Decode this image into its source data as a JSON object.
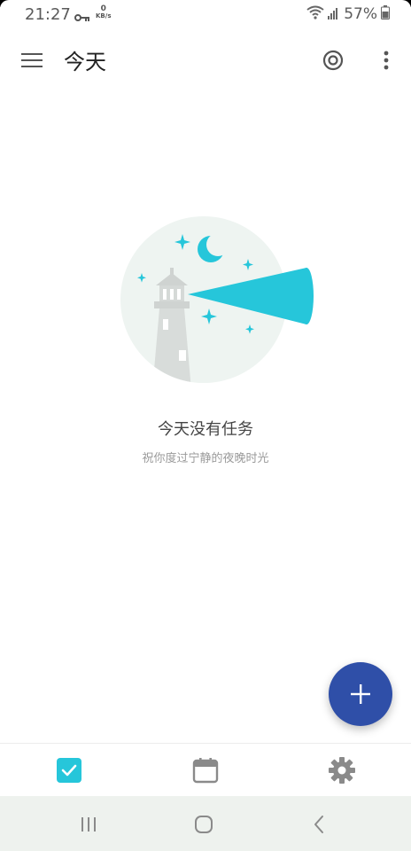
{
  "status_bar": {
    "time": "21:27",
    "net_speed_value": "0",
    "net_speed_unit": "KB/s",
    "battery": "57%",
    "icons": [
      "key-icon",
      "wifi-icon",
      "signal-icon",
      "battery-icon"
    ]
  },
  "app_bar": {
    "title": "今天",
    "icons": [
      "menu-icon",
      "focus-target-icon",
      "more-vert-icon"
    ]
  },
  "empty_state": {
    "title": "今天没有任务",
    "subtitle": "祝你度过宁静的夜晚时光",
    "illustration": "lighthouse-night-illustration"
  },
  "fab": {
    "label": "+",
    "icon": "plus-icon"
  },
  "bottom_nav": {
    "items": [
      {
        "name": "tasks",
        "icon": "checkbox-icon",
        "active": true
      },
      {
        "name": "calendar",
        "icon": "calendar-icon",
        "active": false
      },
      {
        "name": "settings",
        "icon": "gear-icon",
        "active": false
      }
    ]
  },
  "colors": {
    "accent_teal": "#26c6da",
    "fab_blue": "#2f4fa8",
    "icon_gray": "#6d6d6d",
    "illustration_bg": "#eef4f1"
  }
}
